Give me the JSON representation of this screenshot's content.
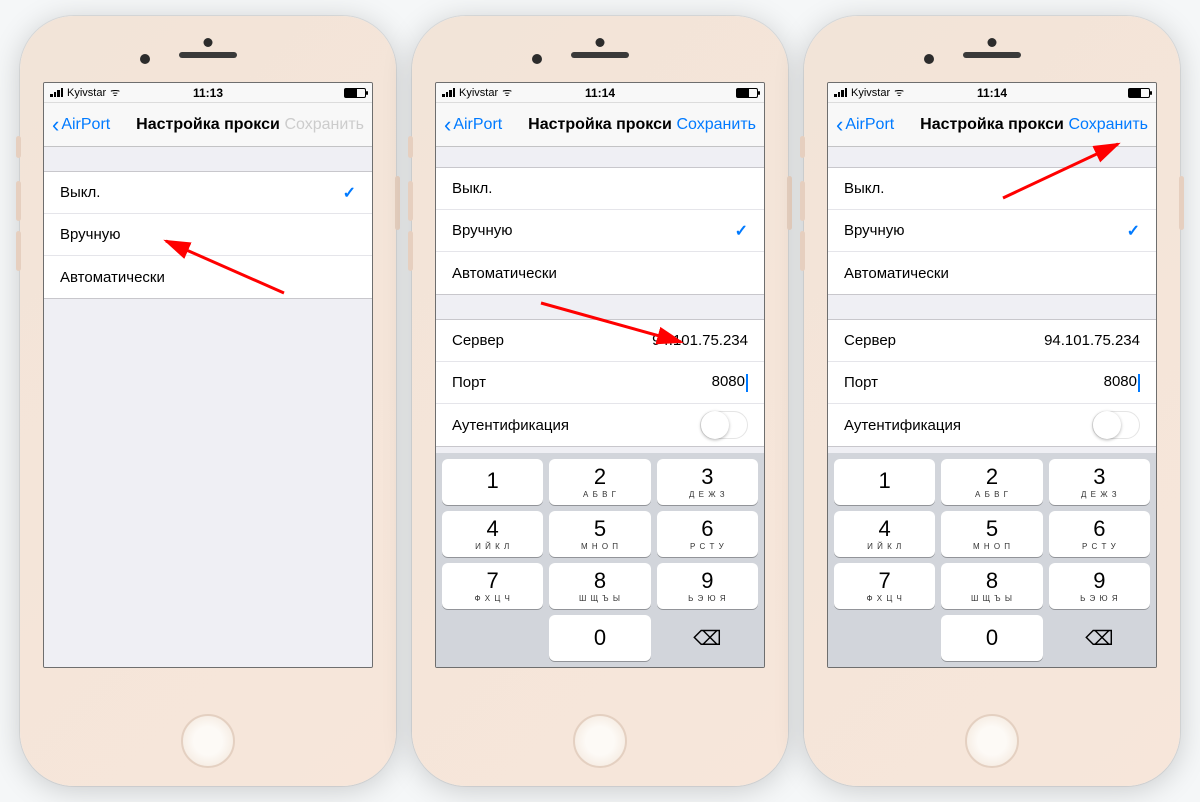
{
  "statusbar": {
    "carrier": "Kyivstar",
    "time1": "11:13",
    "time2": "11:14",
    "time3": "11:14"
  },
  "nav": {
    "back": "AirPort",
    "title": "Настройка прокси",
    "save": "Сохранить"
  },
  "proxy_modes": {
    "off": "Выкл.",
    "manual": "Вручную",
    "auto": "Автоматически"
  },
  "fields": {
    "server_label": "Сервер",
    "port_label": "Порт",
    "auth_label": "Аутентификация",
    "server_value": "94.101.75.234",
    "port_value": "8080"
  },
  "keypad": {
    "k1": {
      "n": "1",
      "l": ""
    },
    "k2": {
      "n": "2",
      "l": "А Б В Г"
    },
    "k3": {
      "n": "3",
      "l": "Д Е Ж З"
    },
    "k4": {
      "n": "4",
      "l": "И Й К Л"
    },
    "k5": {
      "n": "5",
      "l": "М Н О П"
    },
    "k6": {
      "n": "6",
      "l": "Р С Т У"
    },
    "k7": {
      "n": "7",
      "l": "Ф Х Ц Ч"
    },
    "k8": {
      "n": "8",
      "l": "Ш Щ Ъ Ы"
    },
    "k9": {
      "n": "9",
      "l": "Ь Э Ю Я"
    },
    "k0": {
      "n": "0",
      "l": ""
    },
    "del": "⌫"
  }
}
